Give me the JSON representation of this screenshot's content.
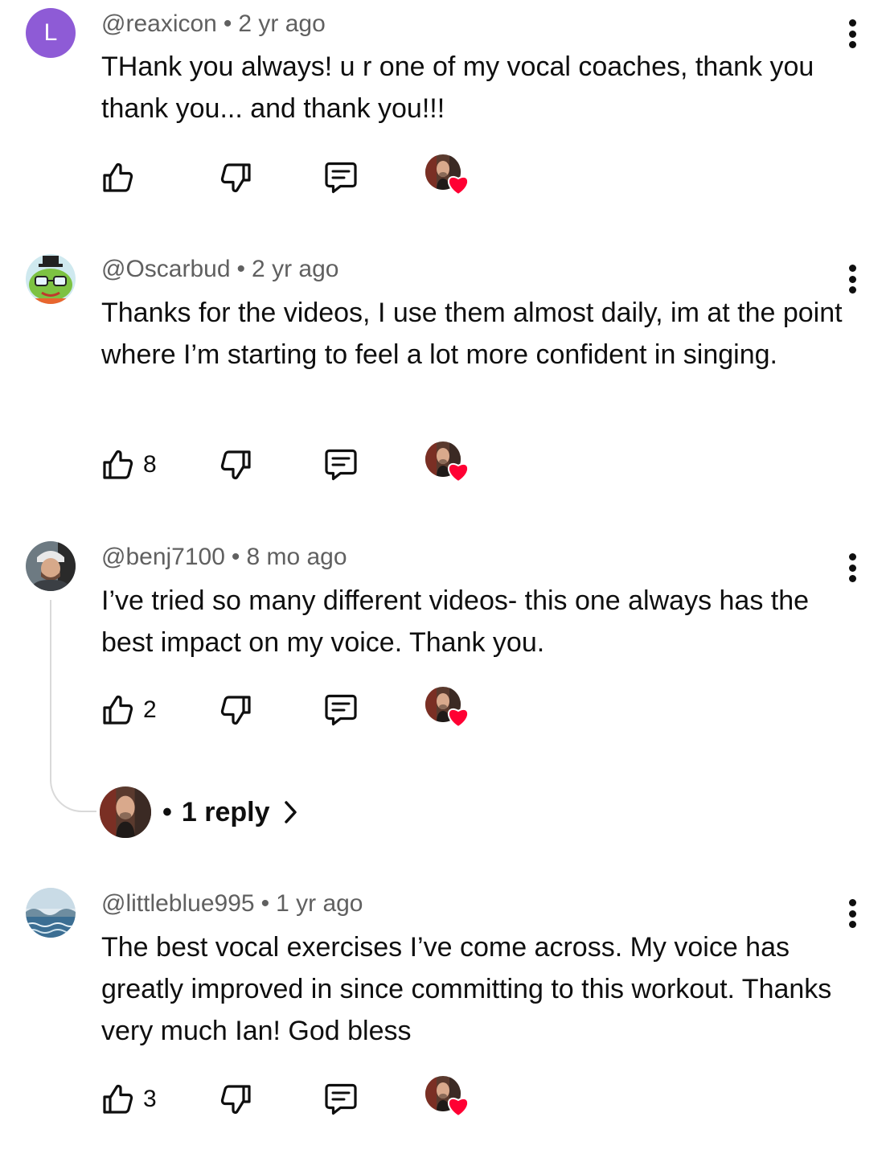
{
  "comments": [
    {
      "avatar_letter": "L",
      "handle": "@reaxicon",
      "separator": "•",
      "time": "2 yr ago",
      "text": "THank you always! u r one of my vocal coaches, thank you thank you... and thank you!!!",
      "likes": "",
      "hearted": true
    },
    {
      "handle": "@Oscarbud",
      "separator": "•",
      "time": "2 yr ago",
      "text": "Thanks for the videos, I use them almost daily, im at the point where I’m starting to feel a lot more confident in singing.",
      "likes": "8",
      "hearted": true
    },
    {
      "handle": "@benj7100",
      "separator": "•",
      "time": "8 mo ago",
      "text": "I’ve tried so many different videos- this one always has the best impact on my voice. Thank you.",
      "likes": "2",
      "hearted": true,
      "replies": {
        "bullet": "•",
        "label": "1 reply"
      }
    },
    {
      "handle": "@littleblue995",
      "separator": "•",
      "time": "1 yr ago",
      "text": "The best vocal exercises I’ve come across. My voice has greatly improved in since committing to this workout. Thanks very much Ian! God bless",
      "likes": "3",
      "hearted": true
    }
  ],
  "icons": {
    "like": "thumbs-up-icon",
    "dislike": "thumbs-down-icon",
    "reply": "comment-reply-icon",
    "more": "more-vertical-icon",
    "heart": "heart-icon",
    "chevron": "chevron-right-icon"
  },
  "colors": {
    "text": "#0f0f0f",
    "meta": "#606060",
    "heart": "#ff0033",
    "avatar_purple": "#8e5bd6"
  }
}
